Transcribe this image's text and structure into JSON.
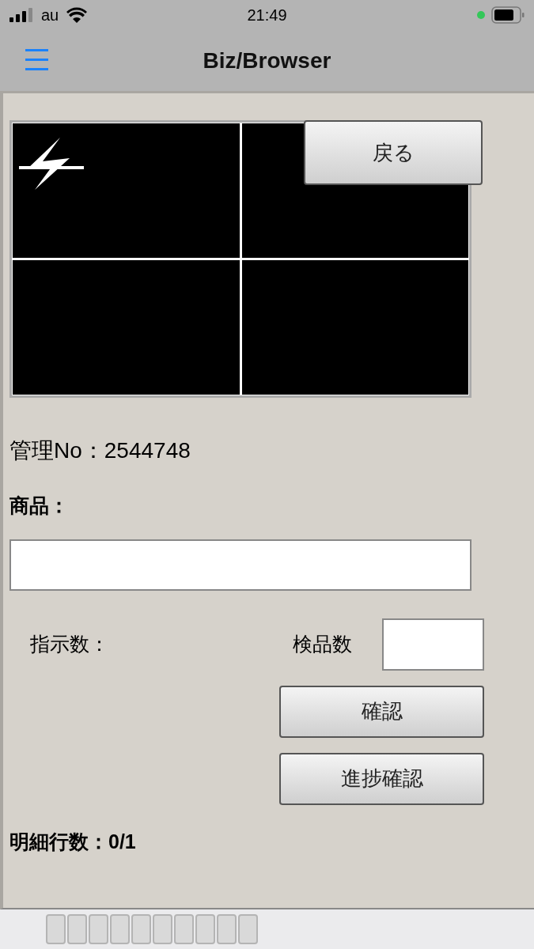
{
  "status_bar": {
    "carrier": "au",
    "time": "21:49"
  },
  "nav": {
    "title": "Biz/Browser"
  },
  "back_button": "戻る",
  "control_no": "管理No：2544748",
  "product": {
    "label": "商品："
  },
  "instruction": {
    "label": "指示数："
  },
  "inspection": {
    "label": "検品数"
  },
  "buttons": [
    "確認",
    "進捗確認"
  ],
  "detail_count": "明細行数：0/1"
}
